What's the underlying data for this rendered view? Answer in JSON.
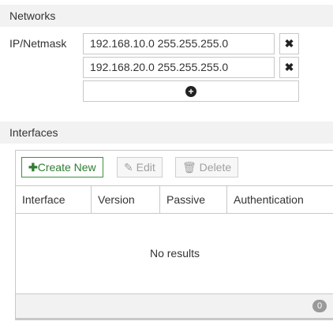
{
  "networks": {
    "title": "Networks",
    "ip_netmask_label": "IP/Netmask",
    "entries": [
      {
        "value": "192.168.10.0 255.255.255.0"
      },
      {
        "value": "192.168.20.0 255.255.255.0"
      }
    ],
    "remove_icon": "close-icon",
    "add_icon": "plus-circle-icon"
  },
  "interfaces": {
    "title": "Interfaces",
    "toolbar": {
      "create_label": "Create New",
      "edit_label": "Edit",
      "delete_label": "Delete"
    },
    "columns": [
      "Interface",
      "Version",
      "Passive",
      "Authentication"
    ],
    "empty_text": "No results",
    "count": "0"
  },
  "colors": {
    "create_accent": "#2e7d32",
    "header_bg": "#f2f2f2",
    "disabled_text": "#a0a0a0"
  }
}
